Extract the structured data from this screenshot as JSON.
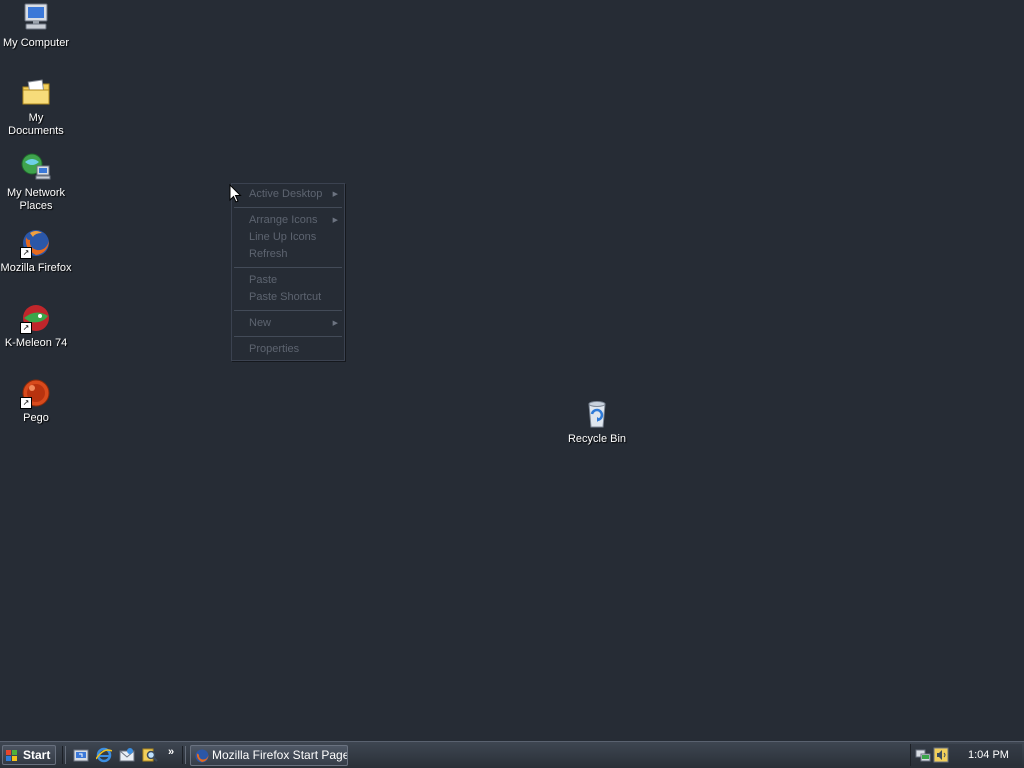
{
  "desktop": {
    "background": "#262c35",
    "icons": [
      {
        "label": "My Computer",
        "icon": "computer-icon"
      },
      {
        "label": "My Documents",
        "icon": "folder-documents-icon"
      },
      {
        "label": "My Network Places",
        "icon": "network-places-icon"
      },
      {
        "label": "Mozilla Firefox",
        "icon": "firefox-icon",
        "shortcut": true
      },
      {
        "label": "K-Meleon 74",
        "icon": "k-meleon-icon",
        "shortcut": true
      },
      {
        "label": "Pego",
        "icon": "pego-icon",
        "shortcut": true
      },
      {
        "label": "Recycle Bin",
        "icon": "recycle-bin-icon"
      }
    ]
  },
  "context_menu": {
    "items": [
      {
        "label": "Active Desktop",
        "submenu": true,
        "enabled": false
      },
      {
        "label": "Arrange Icons",
        "submenu": true,
        "enabled": false
      },
      {
        "label": "Line Up Icons",
        "enabled": false
      },
      {
        "label": "Refresh",
        "enabled": false
      },
      {
        "label": "Paste",
        "enabled": false
      },
      {
        "label": "Paste Shortcut",
        "enabled": false
      },
      {
        "label": "New",
        "submenu": true,
        "enabled": false
      },
      {
        "label": "Properties",
        "enabled": false
      }
    ]
  },
  "taskbar": {
    "start_label": "Start",
    "quick_launch": [
      {
        "icon": "show-desktop-icon"
      },
      {
        "icon": "internet-explorer-icon"
      },
      {
        "icon": "outlook-express-icon"
      },
      {
        "icon": "search-icon"
      }
    ],
    "more_label": "»",
    "task_buttons": [
      {
        "label": "Mozilla Firefox Start Page...",
        "icon": "firefox-icon"
      }
    ],
    "tray": {
      "icons": [
        "network-icon",
        "volume-icon"
      ],
      "clock": "1:04 PM"
    }
  },
  "colors": {
    "desktop_bg": "#262c35",
    "menu_disabled_text": "#5d6470",
    "taskbar_text": "#ffffff"
  }
}
